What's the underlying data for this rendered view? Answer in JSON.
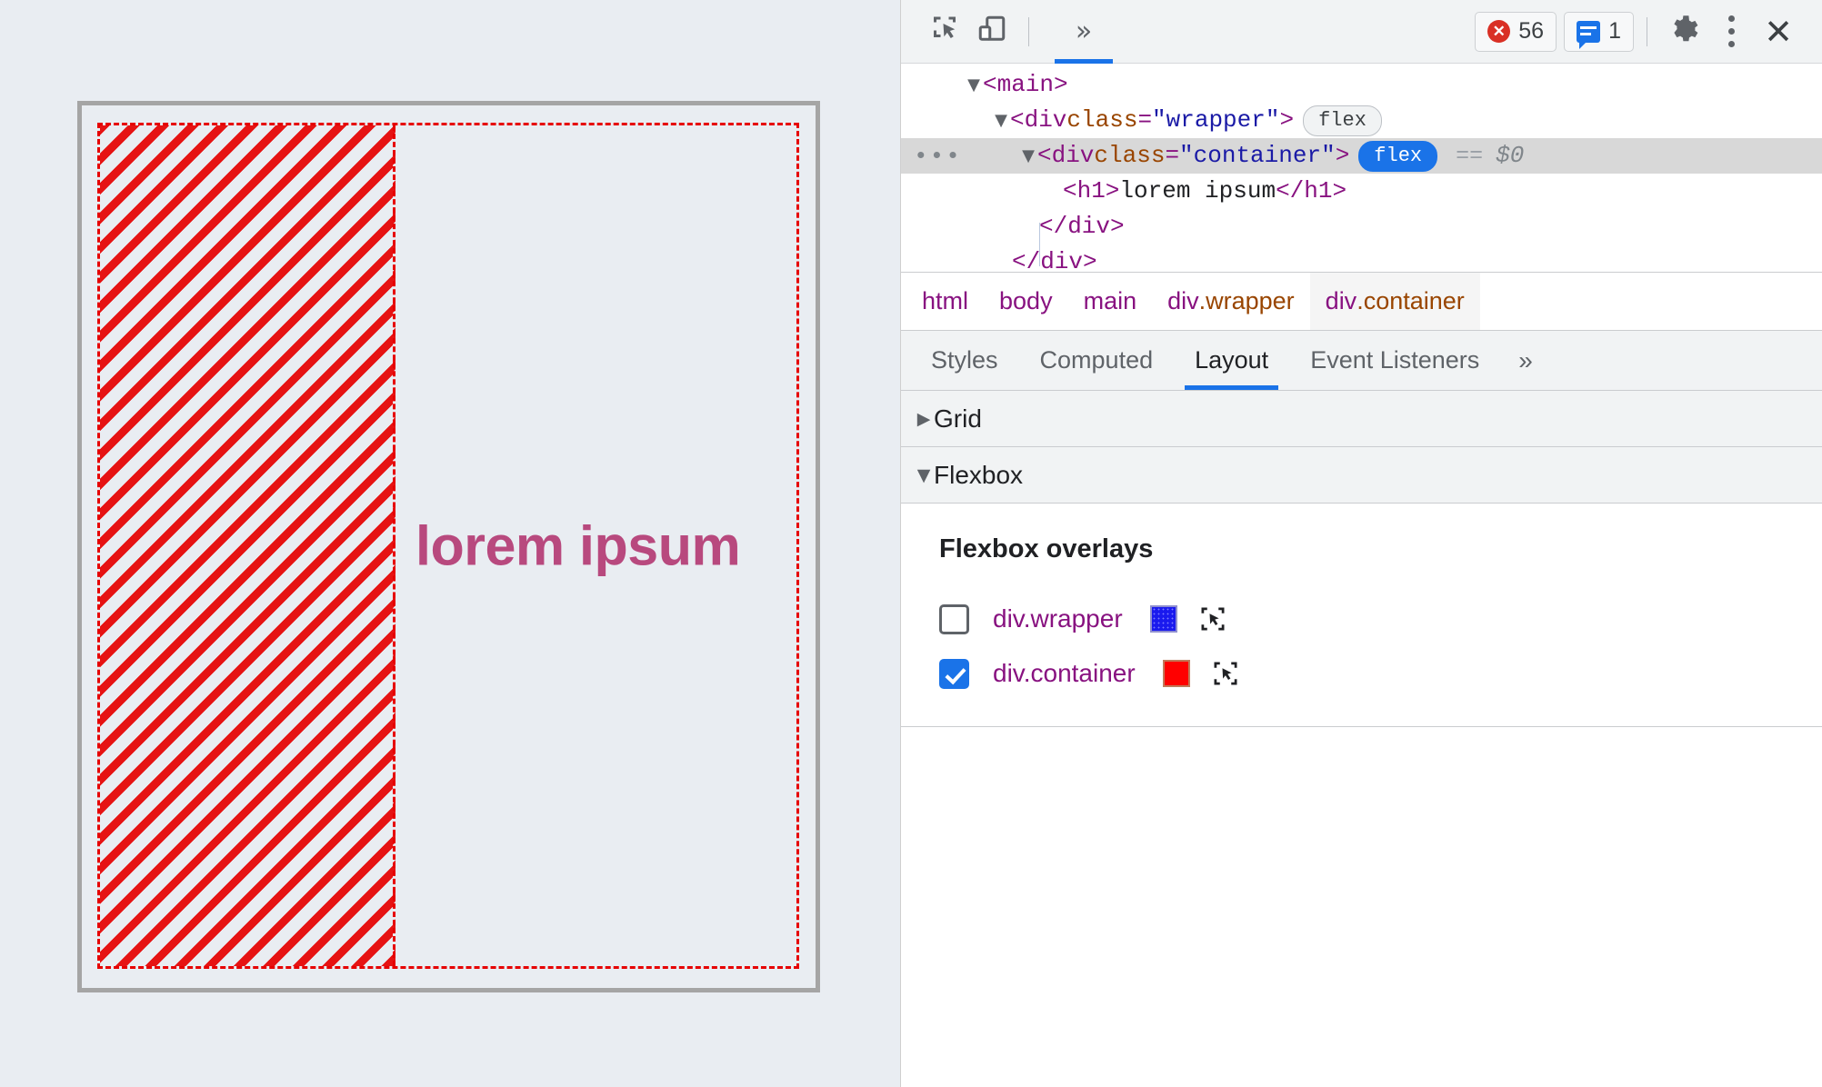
{
  "page_preview": {
    "heading_text": "lorem ipsum",
    "heading_color": "#b8497e",
    "background_color": "#e9edf2",
    "outer_border_color": "#a5a5a5",
    "flex_overlay_color": "#e60000",
    "free_space_hatch": "diagonal-red-dashed"
  },
  "devtools": {
    "toolbar": {
      "inspect_icon": "inspect-element-icon",
      "device_icon": "device-toolbar-icon",
      "overflow_icon": "chevron-double-right-icon",
      "errors": {
        "icon": "error-circle-icon",
        "count": "56"
      },
      "messages": {
        "icon": "message-bubble-icon",
        "count": "1"
      },
      "settings_icon": "gear-icon",
      "more_icon": "kebab-menu-icon",
      "close_icon": "close-icon"
    },
    "dom_tree": {
      "rows": [
        {
          "indent": 1,
          "triangle": "▼",
          "open_tag": "<main>",
          "tag_text": "<main>"
        },
        {
          "indent": 2,
          "triangle": "▼",
          "prefix": "<div ",
          "attr_name": "class",
          "eq": "=",
          "attr_value": "\"wrapper\"",
          "suffix": ">",
          "badge": "flex",
          "badge_active": false
        },
        {
          "indent": 3,
          "triangle": "▼",
          "prefix": "<div ",
          "attr_name": "class",
          "eq": "=",
          "attr_value": "\"container\"",
          "suffix": ">",
          "badge": "flex",
          "badge_active": true,
          "equals_marker": "==",
          "dollar": "$0",
          "selected": true,
          "more_handle": "•••"
        },
        {
          "indent": 4,
          "h1_open": "<h1>",
          "h1_text": "lorem ipsum",
          "h1_close": "</h1>"
        },
        {
          "indent": 3,
          "close_tag": "</div>"
        },
        {
          "indent": 2,
          "close_tag": "</div>"
        }
      ]
    },
    "breadcrumb": {
      "items": [
        {
          "label": "html",
          "active": false
        },
        {
          "label": "body",
          "active": false
        },
        {
          "label": "main",
          "active": false
        },
        {
          "label": "div",
          "cls": ".wrapper",
          "active": false
        },
        {
          "label": "div",
          "cls": ".container",
          "active": true
        }
      ]
    },
    "sidebar_tabs": {
      "items": [
        {
          "label": "Styles",
          "active": false
        },
        {
          "label": "Computed",
          "active": false
        },
        {
          "label": "Layout",
          "active": true
        },
        {
          "label": "Event Listeners",
          "active": false
        }
      ],
      "overflow_label": "»"
    },
    "layout": {
      "grid_section": {
        "label": "Grid",
        "expanded": false,
        "triangle": "▶"
      },
      "flexbox_section": {
        "label": "Flexbox",
        "expanded": true,
        "triangle": "▼"
      },
      "flexbox_overlays": {
        "title": "Flexbox overlays",
        "rows": [
          {
            "label": "div.wrapper",
            "checked": false,
            "color": "#1a1aee",
            "picker_icon": "select-element-icon"
          },
          {
            "label": "div.container",
            "checked": true,
            "color": "#ff0000",
            "picker_icon": "select-element-icon"
          }
        ]
      }
    }
  }
}
